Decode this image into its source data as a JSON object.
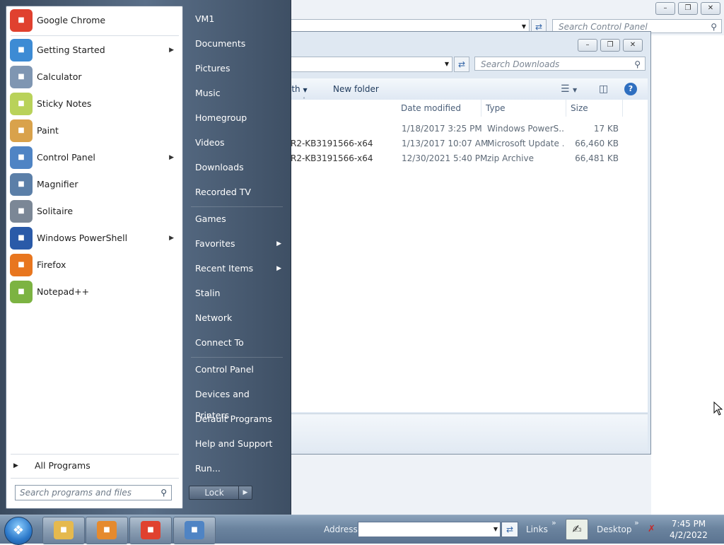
{
  "control_panel": {
    "search_placeholder": "Search Control Panel"
  },
  "downloads": {
    "search_placeholder": "Search Downloads",
    "toolbar": {
      "open_with_partial": "ith",
      "new_folder": "New folder"
    },
    "columns": [
      "Date modified",
      "Type",
      "Size"
    ],
    "rows": [
      {
        "name": "",
        "date": "1/18/2017 3:25 PM",
        "type": "Windows PowerS...",
        "size": "17 KB"
      },
      {
        "name": "R2-KB3191566-x64",
        "date": "1/13/2017 10:07 AM",
        "type": "Microsoft Update ...",
        "size": "66,460 KB"
      },
      {
        "name": "R2-KB3191566-x64",
        "date": "12/30/2021 5:40 PM",
        "type": "zip Archive",
        "size": "66,481 KB"
      }
    ]
  },
  "start_menu": {
    "programs": [
      {
        "label": "Google Chrome",
        "icon": "chrome-icon",
        "color": "#e0412f",
        "has_submenu": false
      },
      {
        "label": "Getting Started",
        "icon": "getting-started-icon",
        "color": "#3d8bd4",
        "has_submenu": true
      },
      {
        "label": "Calculator",
        "icon": "calculator-icon",
        "color": "#7f96b2",
        "has_submenu": false
      },
      {
        "label": "Sticky Notes",
        "icon": "sticky-notes-icon",
        "color": "#b9d25a",
        "has_submenu": false
      },
      {
        "label": "Paint",
        "icon": "paint-icon",
        "color": "#d9a24b",
        "has_submenu": false
      },
      {
        "label": "Control Panel",
        "icon": "control-panel-icon",
        "color": "#4f84c4",
        "has_submenu": true
      },
      {
        "label": "Magnifier",
        "icon": "magnifier-icon",
        "color": "#5b7fa8",
        "has_submenu": false
      },
      {
        "label": "Solitaire",
        "icon": "solitaire-icon",
        "color": "#7b8796",
        "has_submenu": false
      },
      {
        "label": "Windows PowerShell",
        "icon": "powershell-icon",
        "color": "#2a5aa8",
        "has_submenu": true
      },
      {
        "label": "Firefox",
        "icon": "firefox-icon",
        "color": "#e8761f",
        "has_submenu": false
      },
      {
        "label": "Notepad++",
        "icon": "notepadpp-icon",
        "color": "#7cb342",
        "has_submenu": false
      }
    ],
    "all_programs": "All Programs",
    "search_placeholder": "Search programs and files",
    "right_items": [
      {
        "label": "VM1",
        "has_submenu": false
      },
      {
        "label": "Documents",
        "has_submenu": false
      },
      {
        "label": "Pictures",
        "has_submenu": false
      },
      {
        "label": "Music",
        "has_submenu": false
      },
      {
        "label": "Homegroup",
        "has_submenu": false
      },
      {
        "label": "Videos",
        "has_submenu": false
      },
      {
        "label": "Downloads",
        "has_submenu": false
      },
      {
        "label": "Recorded TV",
        "has_submenu": false
      },
      {
        "label": "Games",
        "has_submenu": false
      },
      {
        "label": "Favorites",
        "has_submenu": true
      },
      {
        "label": "Recent Items",
        "has_submenu": true
      },
      {
        "label": "Stalin",
        "has_submenu": false
      },
      {
        "label": "Network",
        "has_submenu": false
      },
      {
        "label": "Connect To",
        "has_submenu": false
      },
      {
        "label": "Control Panel",
        "has_submenu": false
      },
      {
        "label": "Devices and Printers",
        "has_submenu": false
      },
      {
        "label": "Default Programs",
        "has_submenu": false
      },
      {
        "label": "Help and Support",
        "has_submenu": false
      },
      {
        "label": "Run...",
        "has_submenu": false
      }
    ],
    "lock_label": "Lock"
  },
  "taskbar": {
    "address_label": "Address",
    "links_label": "Links",
    "desktop_label": "Desktop",
    "time": "7:45 PM",
    "date": "4/2/2022",
    "pinned": [
      {
        "name": "taskbar-explorer",
        "icon": "folder-icon",
        "color": "#e5b94e"
      },
      {
        "name": "taskbar-media-player",
        "icon": "media-player-icon",
        "color": "#e58a2e"
      },
      {
        "name": "taskbar-chrome",
        "icon": "chrome-icon",
        "color": "#e0412f"
      },
      {
        "name": "taskbar-control-panel",
        "icon": "control-panel-icon",
        "color": "#4f84c4"
      }
    ]
  }
}
